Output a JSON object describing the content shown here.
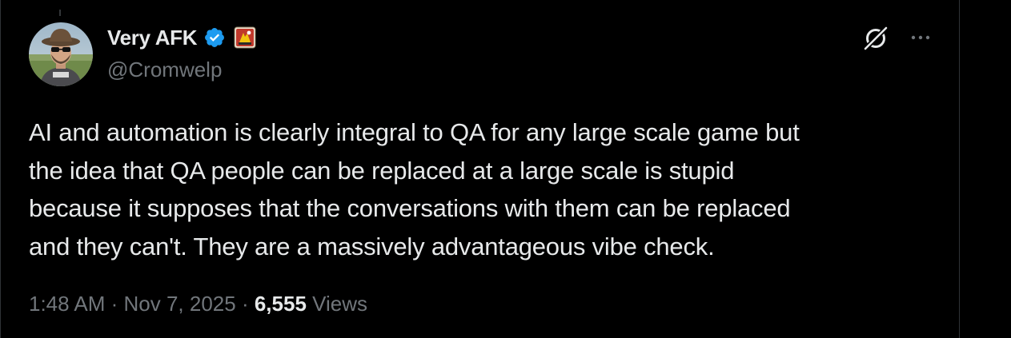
{
  "tweet": {
    "author": {
      "display_name": "Very AFK",
      "handle": "@Cromwelp",
      "verified": true,
      "badge_icon": "affiliate-badge-icon"
    },
    "text": "AI and automation is clearly integral to QA for any large scale game but\nthe idea that QA people can be replaced at a large scale is stupid\nbecause it supposes that the conversations with them can be replaced\nand they can't. They are a massively advantageous vibe check.",
    "meta": {
      "time": "1:48 AM",
      "separator": " · ",
      "date": "Nov 7, 2025",
      "views_count": "6,555",
      "views_label": " Views"
    }
  },
  "icons": {
    "grok": "grok-icon",
    "more": "more-options-icon",
    "verified": "verified-check-icon"
  },
  "colors": {
    "background": "#000000",
    "text_primary": "#e7e9ea",
    "text_secondary": "#71767b",
    "verified_blue": "#1d9bf0",
    "divider": "#2f3336"
  }
}
